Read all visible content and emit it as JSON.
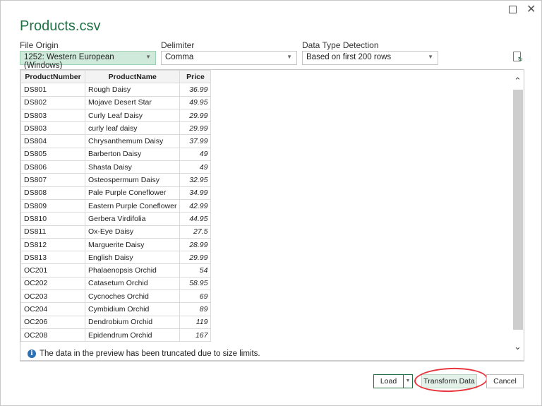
{
  "window": {
    "title": "Products.csv"
  },
  "options": {
    "file_origin": {
      "label": "File Origin",
      "value": "1252: Western European (Windows)"
    },
    "delimiter": {
      "label": "Delimiter",
      "value": "Comma"
    },
    "detection": {
      "label": "Data Type Detection",
      "value": "Based on first 200 rows"
    }
  },
  "table": {
    "headers": [
      "ProductNumber",
      "ProductName",
      "Price"
    ],
    "rows": [
      [
        "DS801",
        "Rough Daisy",
        "36.99"
      ],
      [
        "DS802",
        "Mojave Desert Star",
        "49.95"
      ],
      [
        "DS803",
        "Curly Leaf Daisy",
        "29.99"
      ],
      [
        "DS803",
        "curly leaf daisy",
        "29.99"
      ],
      [
        "DS804",
        "Chrysanthemum Daisy",
        "37.99"
      ],
      [
        "DS805",
        "Barberton Daisy",
        "49"
      ],
      [
        "DS806",
        "Shasta Daisy",
        "49"
      ],
      [
        "DS807",
        "Osteospermum Daisy",
        "32.95"
      ],
      [
        "DS808",
        "Pale Purple Coneflower",
        "34.99"
      ],
      [
        "DS809",
        "Eastern Purple Coneflower",
        "42.99"
      ],
      [
        "DS810",
        "Gerbera Virdifolia",
        "44.95"
      ],
      [
        "DS811",
        "Ox-Eye Daisy",
        "27.5"
      ],
      [
        "DS812",
        "Marguerite Daisy",
        "28.99"
      ],
      [
        "DS813",
        "English Daisy",
        "29.99"
      ],
      [
        "OC201",
        "Phalaenopsis Orchid",
        "54"
      ],
      [
        "OC202",
        "Catasetum Orchid",
        "58.95"
      ],
      [
        "OC203",
        "Cycnoches Orchid",
        "69"
      ],
      [
        "OC204",
        "Cymbidium Orchid",
        "89"
      ],
      [
        "OC206",
        "Dendrobium Orchid",
        "119"
      ],
      [
        "OC208",
        "Epidendrum Orchid",
        "167"
      ]
    ]
  },
  "info": "The data in the preview has been truncated due to size limits.",
  "buttons": {
    "load": "Load",
    "transform": "Transform Data",
    "cancel": "Cancel"
  }
}
